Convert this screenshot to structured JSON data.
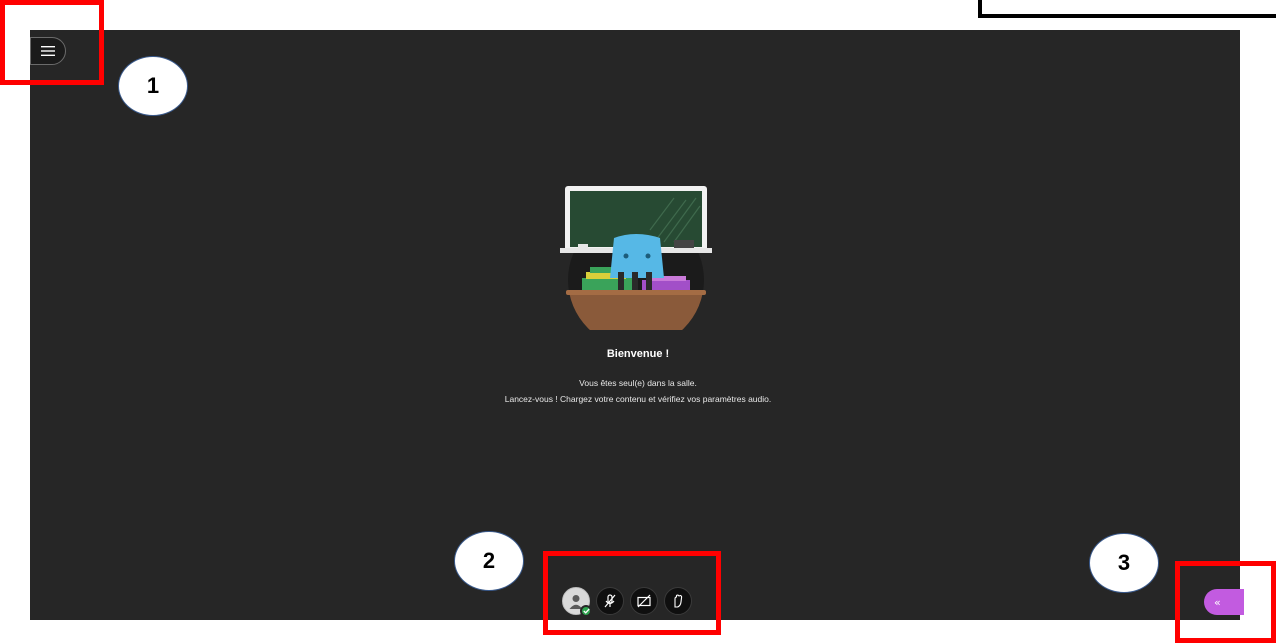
{
  "welcome": {
    "title": "Bienvenue !",
    "line1": "Vous êtes seul(e) dans la salle.",
    "line2": "Lancez-vous ! Chargez votre contenu et vérifiez vos paramètres audio."
  },
  "icons": {
    "menu": "hamburger-menu-icon",
    "avatar": "user-avatar-icon",
    "microphone": "microphone-off-icon",
    "camera": "camera-off-icon",
    "hand": "raise-hand-icon",
    "panel": "double-chevron-left-icon"
  },
  "panel_toggle": {
    "label": "«"
  },
  "callouts": [
    "1",
    "2",
    "3"
  ],
  "colors": {
    "stage": "#262626",
    "accent": "#c25be0",
    "status_ok": "#2ea44f",
    "annotation": "#ff0000"
  }
}
